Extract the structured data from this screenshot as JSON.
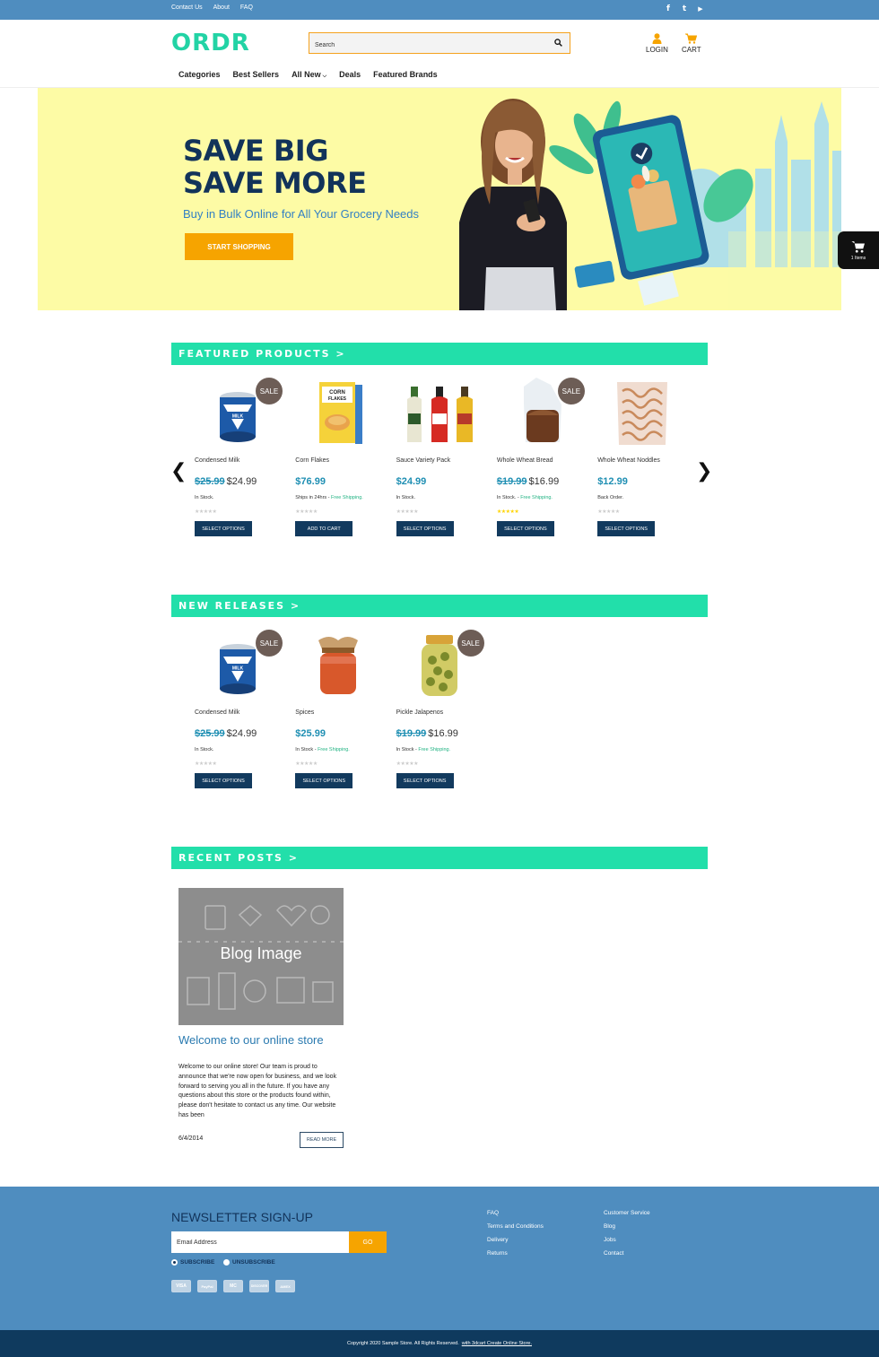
{
  "topbar": {
    "links": [
      "Contact Us",
      "About",
      "FAQ"
    ],
    "social": [
      {
        "icon": "facebook-icon",
        "glyph": "f"
      },
      {
        "icon": "twitter-icon",
        "glyph": "t"
      },
      {
        "icon": "youtube-icon",
        "glyph": "▶"
      }
    ]
  },
  "header": {
    "logo": "ORDR",
    "search_placeholder": "Search",
    "login_label": "LOGIN",
    "cart_label": "CART"
  },
  "nav": {
    "items": [
      "Categories",
      "Best Sellers",
      "All New",
      "Deals",
      "Featured Brands"
    ],
    "dropdown_item": "All New"
  },
  "hero": {
    "headline_line1": "SAVE BIG",
    "headline_line2": "SAVE MORE",
    "subtitle": "Buy in Bulk Online for All Your Grocery Needs",
    "cta": "START SHOPPING"
  },
  "side_cart": {
    "label": "1 Items"
  },
  "sections": {
    "featured": "FEATURED PRODUCTS >",
    "new_releases": "NEW RELEASES >",
    "recent_posts": "RECENT POSTS >"
  },
  "featured_products": [
    {
      "name": "Condensed Milk",
      "sale": true,
      "old_price": "$25.99",
      "price": "$24.99",
      "stock": "In Stock.",
      "shipping": "",
      "rating": 0,
      "button": "SELECT OPTIONS",
      "image": "milk-can"
    },
    {
      "name": "Corn Flakes",
      "sale": false,
      "old_price": "",
      "price": "$76.99",
      "stock": "Ships in 24hrs - ",
      "shipping": "Free Shipping.",
      "rating": 0,
      "button": "ADD TO CART",
      "image": "cereal-box"
    },
    {
      "name": "Sauce Variety Pack",
      "sale": false,
      "old_price": "",
      "price": "$24.99",
      "stock": "In Stock.",
      "shipping": "",
      "rating": 0,
      "button": "SELECT OPTIONS",
      "image": "sauce-bottles"
    },
    {
      "name": "Whole Wheat Bread",
      "sale": true,
      "old_price": "$19.99",
      "price": "$16.99",
      "stock": "In Stock. - ",
      "shipping": "Free Shipping.",
      "rating": 5,
      "button": "SELECT OPTIONS",
      "image": "bread"
    },
    {
      "name": "Whole Wheat Noddles",
      "sale": false,
      "old_price": "",
      "price": "$12.99",
      "stock": "Back Order.",
      "shipping": "",
      "rating": 0,
      "button": "SELECT OPTIONS",
      "image": "noodles-bag"
    }
  ],
  "new_releases": [
    {
      "name": "Condensed Milk",
      "sale": true,
      "old_price": "$25.99",
      "price": "$24.99",
      "stock": "In Stock.",
      "shipping": "",
      "rating": 0,
      "button": "SELECT OPTIONS",
      "image": "milk-can"
    },
    {
      "name": "Spices",
      "sale": false,
      "old_price": "",
      "price": "$25.99",
      "stock": "In Stock - ",
      "shipping": "Free Shipping.",
      "rating": 0,
      "button": "SELECT OPTIONS",
      "image": "spice-jar"
    },
    {
      "name": "Pickle Jalapenos",
      "sale": true,
      "old_price": "$19.99",
      "price": "$16.99",
      "stock": "In Stock - ",
      "shipping": "Free Shipping.",
      "rating": 0,
      "button": "SELECT OPTIONS",
      "image": "pickle-jar"
    }
  ],
  "sale_label": "SALE",
  "blog": {
    "image_label": "Blog Image",
    "title": "Welcome to our online store",
    "body": "Welcome to our online store! Our team is proud to announce that we're now open for business, and we look forward to serving you all in the future. If you have any questions about this store or the products found within, please don't hesitate to contact us any time. Our website has been",
    "date": "6/4/2014",
    "read_more": "READ MORE"
  },
  "footer": {
    "newsletter_title": "NEWSLETTER SIGN-UP",
    "email_placeholder": "Email Address",
    "go": "GO",
    "subscribe": "SUBSCRIBE",
    "unsubscribe": "UNSUBSCRIBE",
    "payment_cards": [
      "VISA",
      "PayPal",
      "MC",
      "DISCOVER",
      "AMEX"
    ],
    "col1": [
      "FAQ",
      "Terms and Conditions",
      "Delivery",
      "Returns"
    ],
    "col2": [
      "Customer Service",
      "Blog",
      "Jobs",
      "Contact"
    ],
    "copyright": "Copyright 2020 Sample Store. All Rights Reserved.",
    "copyright_link": "with 3dcart Create Online Store."
  },
  "colors": {
    "topbar": "#4f8dbf",
    "logo": "#22d3a5",
    "accent_orange": "#f6a400",
    "section_header": "#22dfaa",
    "button_navy": "#123a5e",
    "hero_bg": "#fdfba5",
    "sale_badge": "#6d5d56"
  }
}
